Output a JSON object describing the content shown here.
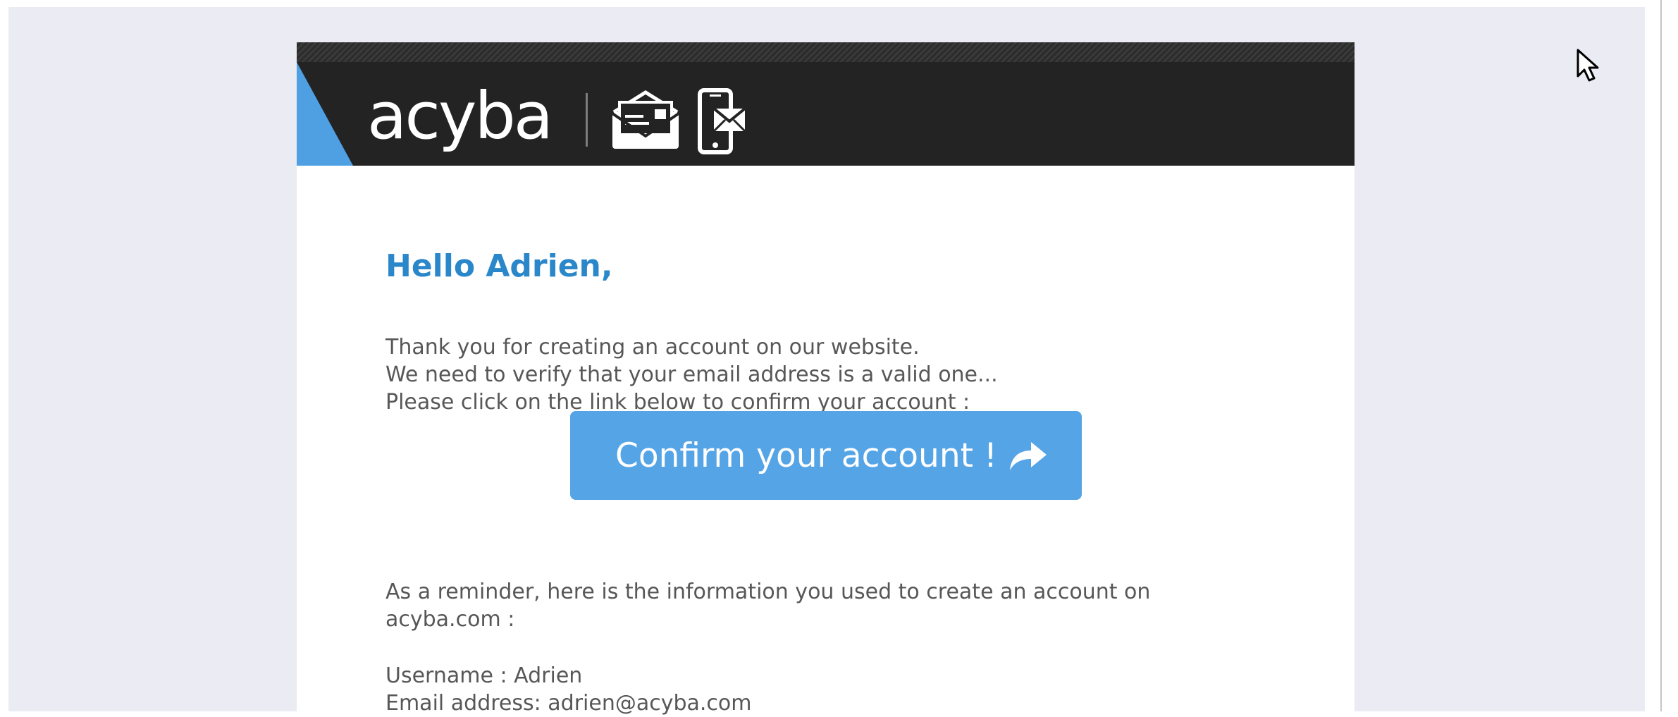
{
  "email": {
    "brand": {
      "name": "acyba",
      "icons": [
        "mail-envelope-icon",
        "phone-mail-icon"
      ]
    },
    "greeting": "Hello Adrien,",
    "intro_lines": [
      "Thank you for creating an account on our website.",
      "We need to verify that your email address is a valid one...",
      "Please click on the link below to confirm your account :"
    ],
    "confirm_button": {
      "label": "Confirm your account !",
      "icon": "arrow-right-icon"
    },
    "reminder_lines": [
      "As a reminder, here is the information you used to create an account on",
      "acyba.com :"
    ],
    "credentials": {
      "username_line": "Username : Adrien",
      "email_line": "Email address: adrien@acyba.com"
    }
  },
  "colors": {
    "page_background": "#ebebf4",
    "header_background": "#232323",
    "accent_blue": "#2a87c9",
    "button_blue": "#55a4e6",
    "corner_blue": "#4f9fe3",
    "body_text": "#575757"
  },
  "cursor": {
    "icon": "mouse-pointer-icon"
  }
}
